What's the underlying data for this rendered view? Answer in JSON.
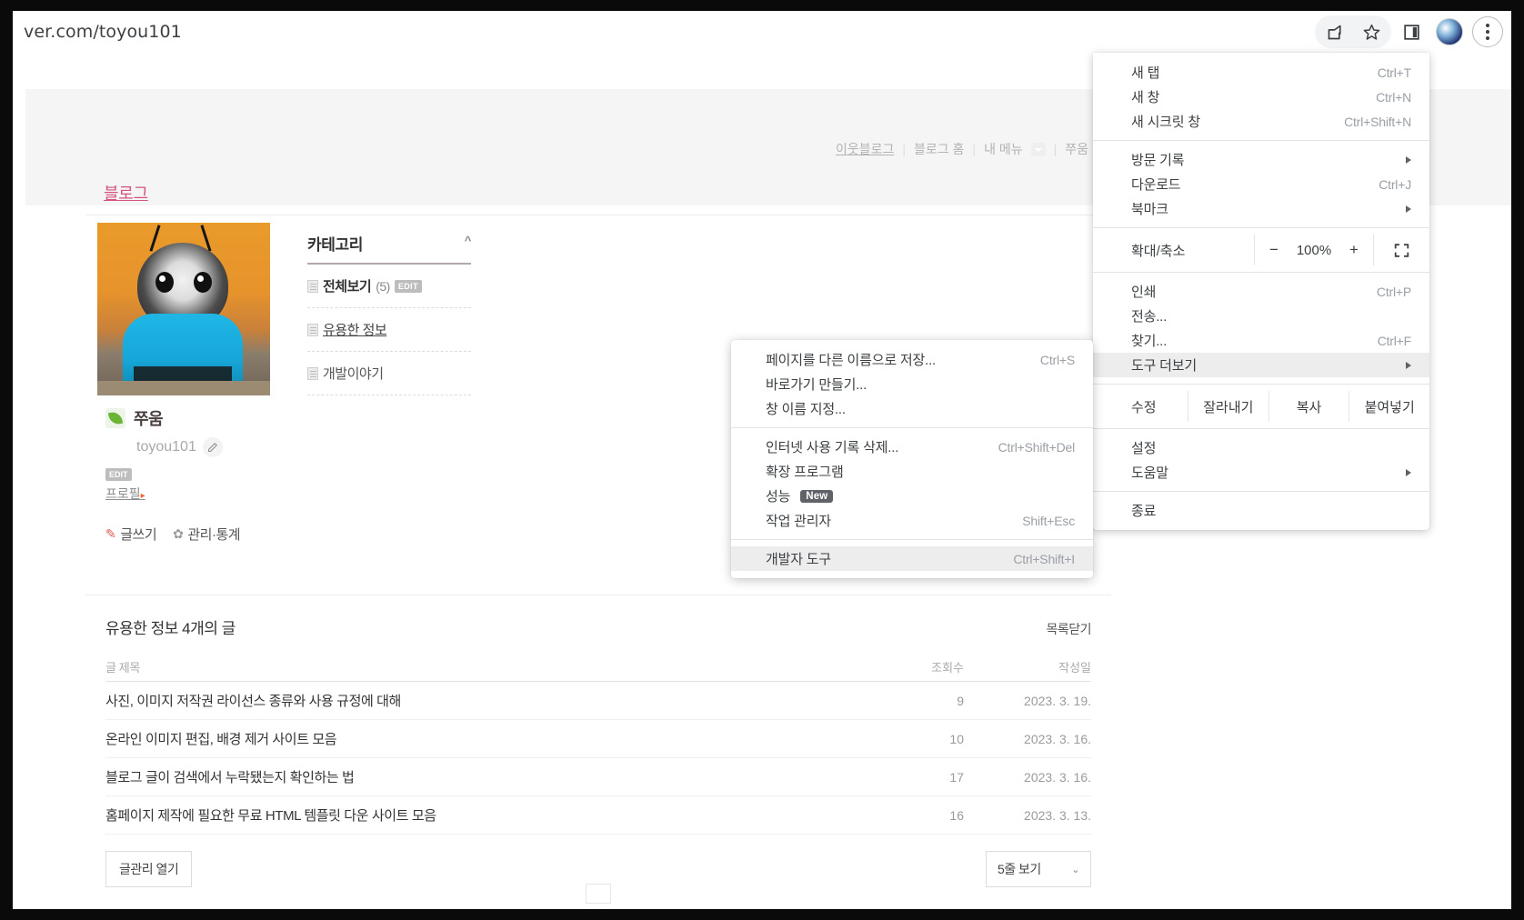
{
  "browser": {
    "url": "ver.com/toyou101",
    "toolbar_icons": [
      "share-icon",
      "bookmark-star-icon",
      "side-panel-icon",
      "profile-avatar",
      "chrome-menu-kebab"
    ]
  },
  "blog": {
    "gnb": {
      "neighbor": "이웃블로그",
      "home": "블로그 홈",
      "my_menu": "내 메뉴",
      "user": "쭈움"
    },
    "blog_label": "블로그",
    "category": {
      "title": "카테고리",
      "collapse_icon": "^",
      "items": [
        {
          "name": "전체보기",
          "count": "(5)",
          "badge": "EDIT",
          "style": "bold"
        },
        {
          "name": "유용한 정보",
          "count": "",
          "badge": "",
          "style": "link"
        },
        {
          "name": "개발이야기",
          "count": "",
          "badge": "",
          "style": "plain"
        }
      ]
    },
    "owner": {
      "name": "쭈움",
      "id": "toyou101",
      "edit_badge": "EDIT",
      "profile_link": "프로필",
      "profile_arrow": "▸"
    },
    "actions": [
      {
        "label": "글쓰기",
        "icon": "pencil-icon"
      },
      {
        "label": "관리·통계",
        "icon": "gear-icon"
      }
    ],
    "posts": {
      "heading": "유용한 정보 4개의 글",
      "close_label": "목록닫기",
      "columns": {
        "title": "글 제목",
        "views": "조회수",
        "date": "작성일"
      },
      "rows": [
        {
          "title": "사진, 이미지 저작권 라이선스 종류와 사용 규정에 대해",
          "views": "9",
          "date": "2023. 3. 19."
        },
        {
          "title": "온라인 이미지 편집, 배경 제거 사이트 모음",
          "views": "10",
          "date": "2023. 3. 16."
        },
        {
          "title": "블로그 글이 검색에서 누락됐는지 확인하는 법",
          "views": "17",
          "date": "2023. 3. 16."
        },
        {
          "title": "홈페이지 제작에 필요한 무료 HTML 템플릿 다운 사이트 모음",
          "views": "16",
          "date": "2023. 3. 13."
        }
      ],
      "manage_button": "글관리 열기",
      "rows_select": "5줄 보기"
    }
  },
  "chrome_menu": {
    "groups": [
      {
        "items": [
          {
            "label": "새 탭",
            "shortcut": "Ctrl+T",
            "submenu": false
          },
          {
            "label": "새 창",
            "shortcut": "Ctrl+N",
            "submenu": false
          },
          {
            "label": "새 시크릿 창",
            "shortcut": "Ctrl+Shift+N",
            "submenu": false
          }
        ]
      },
      {
        "items": [
          {
            "label": "방문 기록",
            "shortcut": "",
            "submenu": true
          },
          {
            "label": "다운로드",
            "shortcut": "Ctrl+J",
            "submenu": false
          },
          {
            "label": "북마크",
            "shortcut": "",
            "submenu": true
          }
        ]
      }
    ],
    "zoom": {
      "label": "확대/축소",
      "minus": "−",
      "value": "100%",
      "plus": "+",
      "fullscreen_icon": "fullscreen-icon"
    },
    "after_zoom": [
      {
        "label": "인쇄",
        "shortcut": "Ctrl+P",
        "submenu": false
      },
      {
        "label": "전송...",
        "shortcut": "",
        "submenu": false
      },
      {
        "label": "찾기...",
        "shortcut": "Ctrl+F",
        "submenu": false
      },
      {
        "label": "도구 더보기",
        "shortcut": "",
        "submenu": true,
        "highlight": true
      }
    ],
    "edit_row": {
      "label": "수정",
      "cut": "잘라내기",
      "copy": "복사",
      "paste": "붙여넣기"
    },
    "tail": [
      {
        "label": "설정",
        "shortcut": "",
        "submenu": false
      },
      {
        "label": "도움말",
        "shortcut": "",
        "submenu": true
      }
    ],
    "exit": {
      "label": "종료",
      "shortcut": ""
    }
  },
  "more_tools_submenu": {
    "group1": [
      {
        "label": "페이지를 다른 이름으로 저장...",
        "shortcut": "Ctrl+S"
      },
      {
        "label": "바로가기 만들기...",
        "shortcut": ""
      },
      {
        "label": "창 이름 지정...",
        "shortcut": ""
      }
    ],
    "group2": [
      {
        "label": "인터넷 사용 기록 삭제...",
        "shortcut": "Ctrl+Shift+Del",
        "badge": ""
      },
      {
        "label": "확장 프로그램",
        "shortcut": "",
        "badge": ""
      },
      {
        "label": "성능",
        "shortcut": "",
        "badge": "New"
      },
      {
        "label": "작업 관리자",
        "shortcut": "Shift+Esc",
        "badge": ""
      }
    ],
    "group3": [
      {
        "label": "개발자 도구",
        "shortcut": "Ctrl+Shift+I",
        "highlight": true
      }
    ]
  }
}
